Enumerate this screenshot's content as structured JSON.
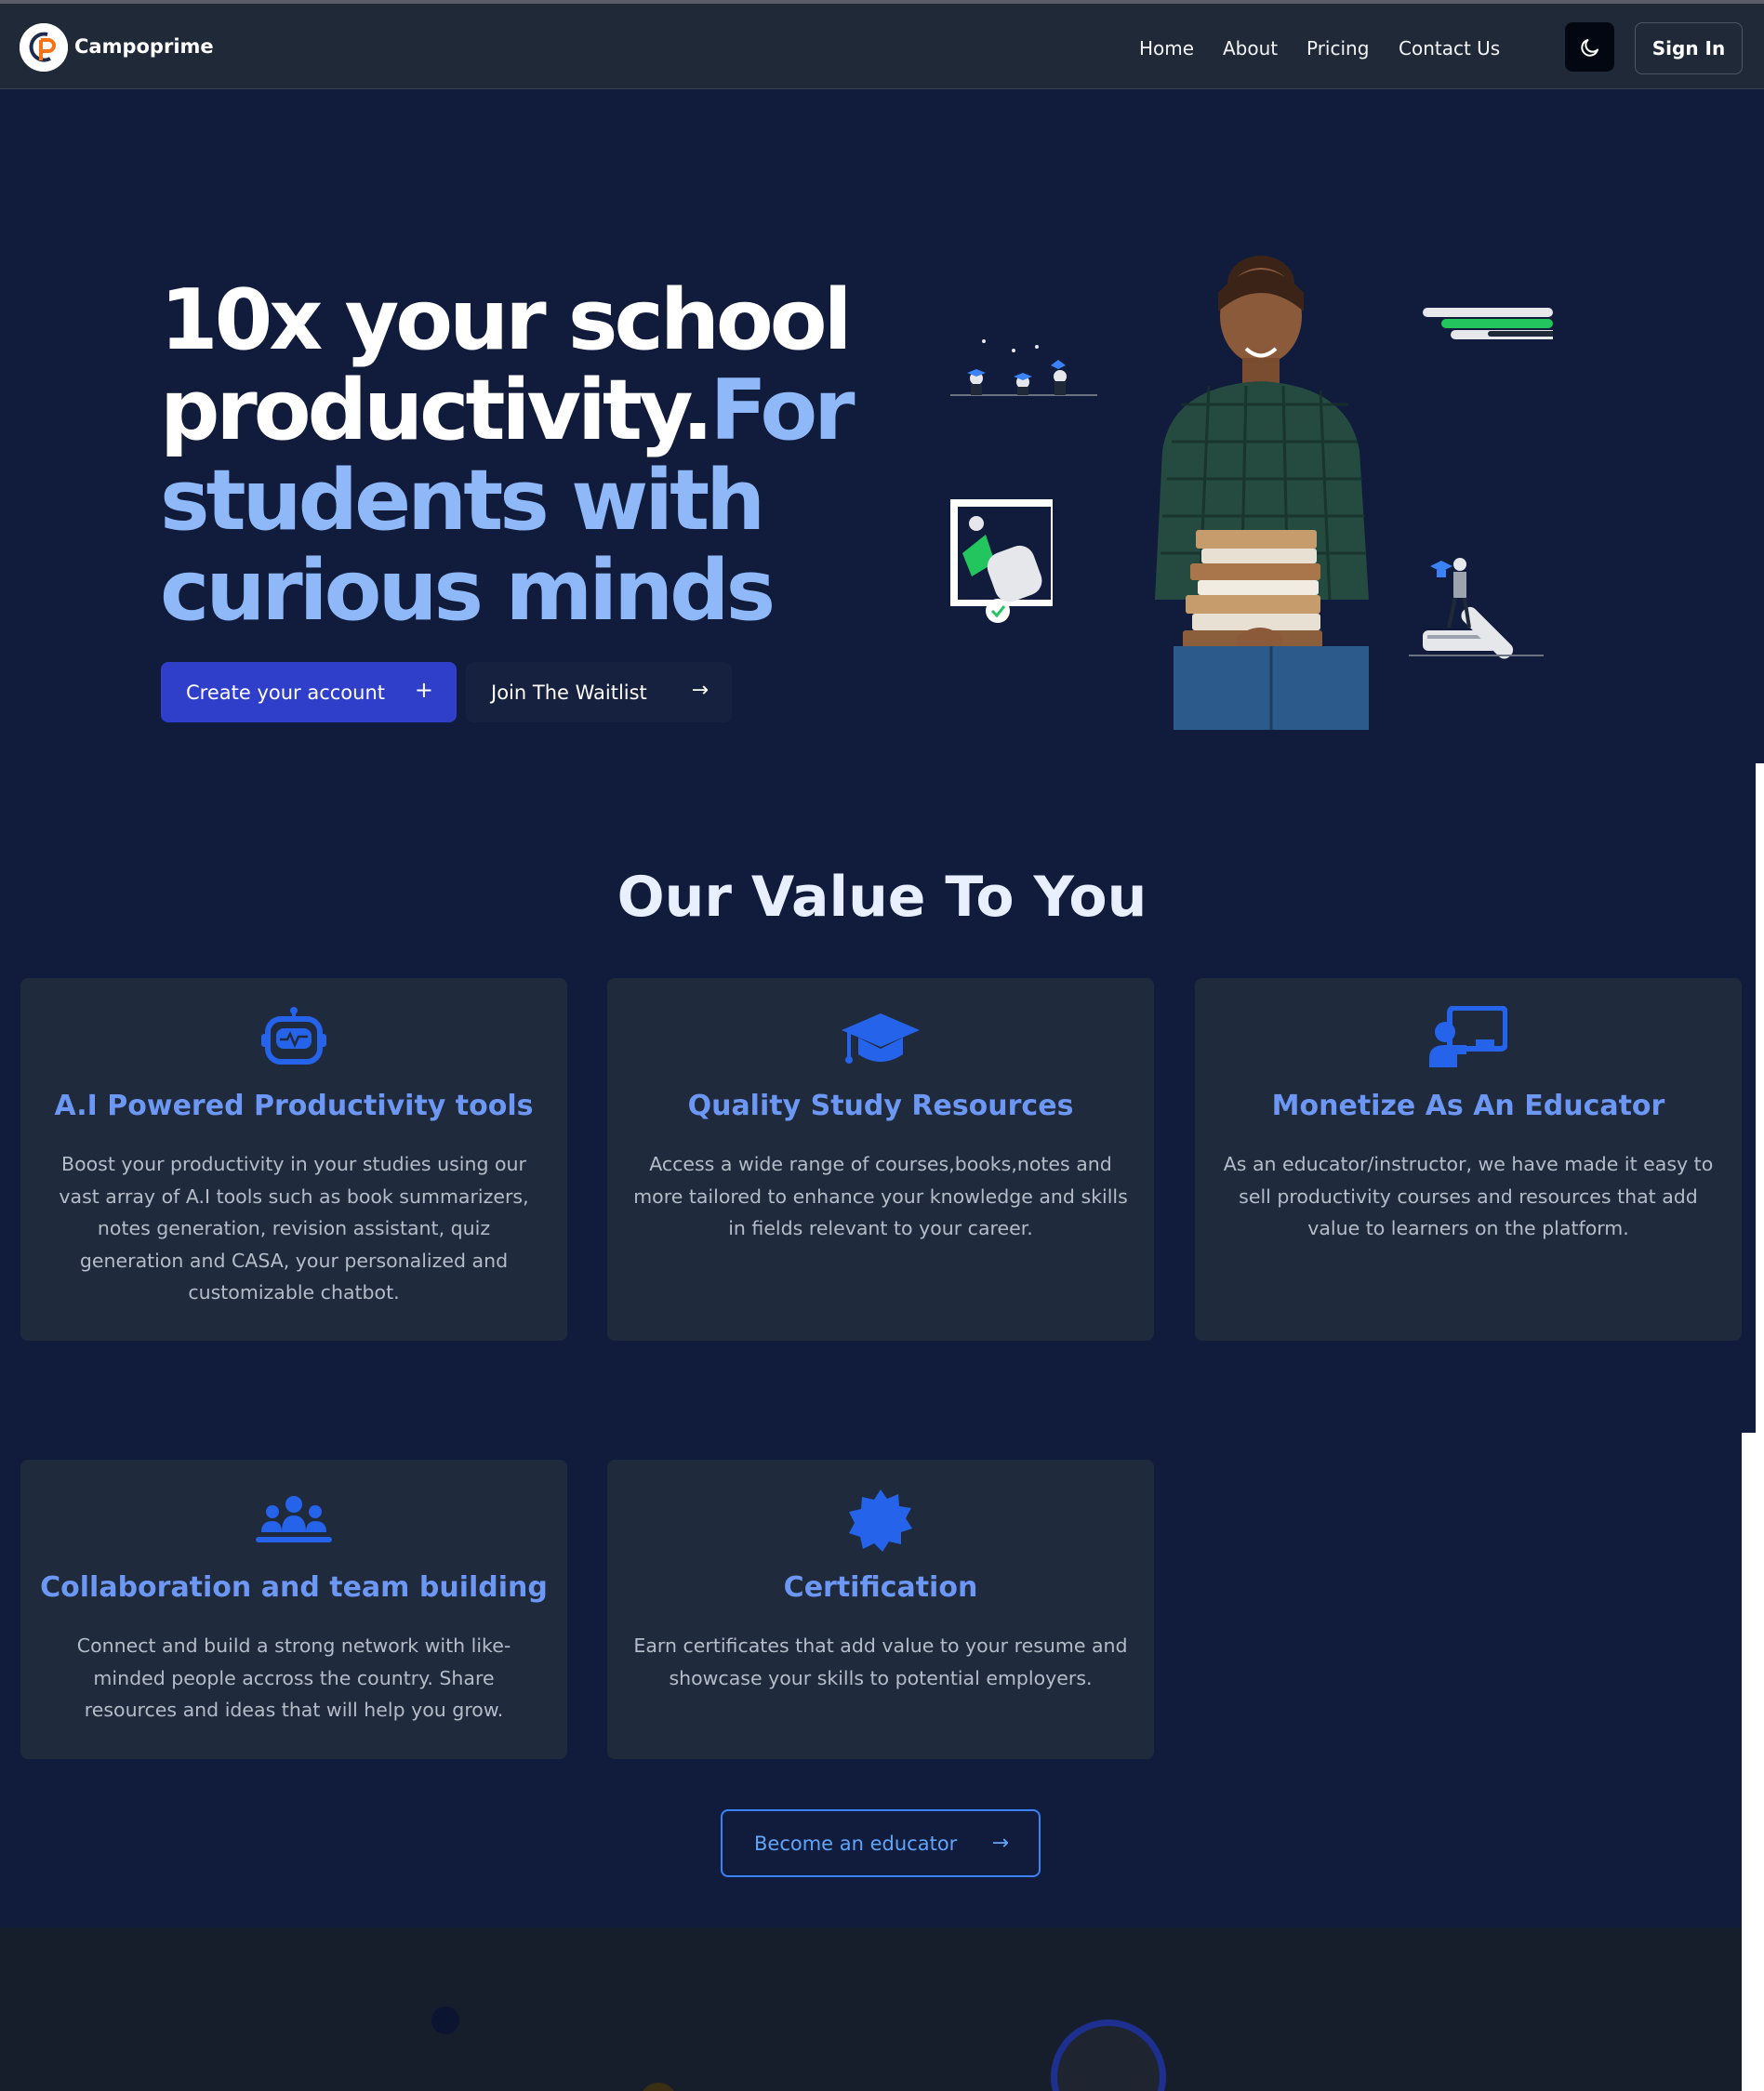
{
  "nav": {
    "brand": "Campoprime",
    "links": [
      "Home",
      "About",
      "Pricing",
      "Contact Us"
    ],
    "sign_in": "Sign In",
    "theme_icon": "moon-icon"
  },
  "hero": {
    "title_part1": "10x your school productivity.",
    "title_part2": "For students with curious minds",
    "primary_button": "Create your account",
    "primary_button_icon": "+",
    "secondary_button": "Join The Waitlist",
    "secondary_button_icon": "→"
  },
  "values": {
    "title": "Our Value To You",
    "cards": [
      {
        "icon": "robot-icon",
        "title": "A.I Powered Productivity tools",
        "text": "Boost your productivity in your studies using our vast array of A.I tools such as book summarizers, notes generation, revision assistant, quiz generation and CASA, your personalized and customizable chatbot."
      },
      {
        "icon": "graduation-cap-icon",
        "title": "Quality Study Resources",
        "text": "Access a wide range of courses,books,notes and more tailored to enhance your knowledge and skills in fields relevant to your career."
      },
      {
        "icon": "teacher-board-icon",
        "title": "Monetize As An Educator",
        "text": "As an educator/instructor, we have made it easy to sell productivity courses and resources that add value to learners on the platform."
      },
      {
        "icon": "people-group-icon",
        "title": "Collaboration and team building",
        "text": "Connect and build a strong network with like-minded people accross the country. Share resources and ideas that will help you grow."
      },
      {
        "icon": "certificate-icon",
        "title": "Certification",
        "text": "Earn certificates that add value to your resume and showcase your skills to potential employers."
      }
    ],
    "educator_button": "Become an educator",
    "educator_button_icon": "→"
  },
  "colors": {
    "nav_bg": "#1f2937",
    "page_bg": "#111c3d",
    "card_bg": "#1f2a3c",
    "accent_blue": "#6d97f4",
    "hero_accent": "#8fb8f8",
    "primary_button": "#2f3fc9"
  }
}
